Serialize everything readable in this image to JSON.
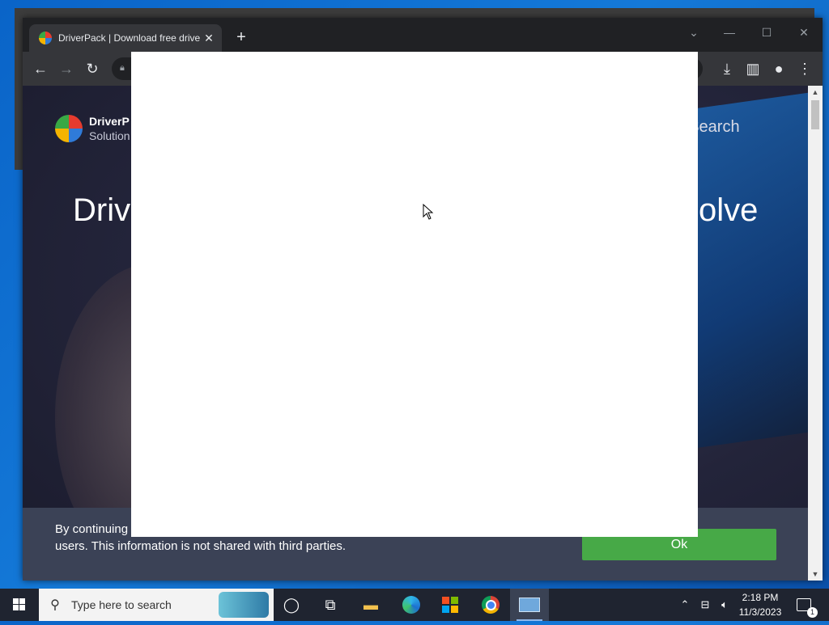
{
  "browser": {
    "tab_title": "DriverPack | Download free drive",
    "tab_close": "✕",
    "new_tab": "+"
  },
  "page": {
    "brand_name": "DriverP",
    "brand_sub": "Solution",
    "search_link": "r Search",
    "hero_left": "Driv",
    "hero_right": "olve",
    "cookie_text": "By continuing Cookie files. It is done so to provide comfortable work for our users. This information is not shared with third parties.",
    "ok_label": "Ok"
  },
  "taskbar": {
    "search_placeholder": "Type here to search",
    "time": "2:18 PM",
    "date": "11/3/2023",
    "notification_count": "1"
  },
  "colors": {
    "ok_button": "#47a947",
    "cookie_bar": "#3b4256",
    "desktop": "#0a64c8"
  }
}
